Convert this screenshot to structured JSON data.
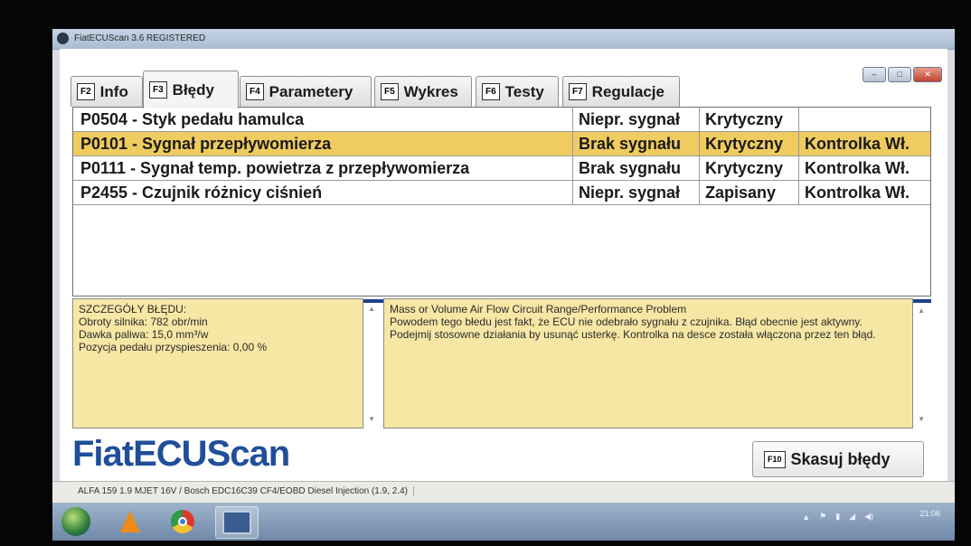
{
  "window": {
    "title": "FiatECUScan 3.6 REGISTERED",
    "controls": {
      "minimize": "–",
      "maximize": "□",
      "close": "✕"
    }
  },
  "tabs": [
    {
      "key": "F2",
      "label": "Info"
    },
    {
      "key": "F3",
      "label": "Błędy",
      "active": true
    },
    {
      "key": "F4",
      "label": "Parametery"
    },
    {
      "key": "F5",
      "label": "Wykres"
    },
    {
      "key": "F6",
      "label": "Testy"
    },
    {
      "key": "F7",
      "label": "Regulacje"
    }
  ],
  "fault_codes": [
    {
      "code": "P0504 - Styk pedału hamulca",
      "signal": "Niepr. sygnał",
      "severity": "Krytyczny",
      "lamp": ""
    },
    {
      "code": "P0101 - Sygnał przepływomierza",
      "signal": "Brak sygnału",
      "severity": "Krytyczny",
      "lamp": "Kontrolka Wł.",
      "selected": true
    },
    {
      "code": "P0111 - Sygnał temp. powietrza z przepływomierza",
      "signal": "Brak sygnału",
      "severity": "Krytyczny",
      "lamp": "Kontrolka Wł."
    },
    {
      "code": "P2455 - Czujnik różnicy ciśnień",
      "signal": "Niepr. sygnał",
      "severity": "Zapisany",
      "lamp": "Kontrolka Wł."
    }
  ],
  "details": {
    "heading": "SZCZEGÓŁY BŁĘDU:",
    "lines": [
      "Obroty silnika: 782 obr/min",
      "Dawka paliwa: 15,0 mm³/w",
      "Pozycja pedału przyspieszenia: 0,00 %"
    ]
  },
  "description": {
    "title": "Mass or Volume Air Flow Circuit Range/Performance Problem",
    "text": "Powodem tego błedu jest fakt, że ECU nie odebrało sygnału z czujnika. Błąd obecnie jest aktywny. Podejmij stosowne działania by usunąć usterkę. Kontrolka na desce została włączona przez ten błąd."
  },
  "logo": "FiatECUScan",
  "clear_button": {
    "key": "F10",
    "label": "Skasuj błędy"
  },
  "status": "ALFA 159 1.9 MJET 16V / Bosch EDC16C39 CF4/EOBD Diesel Injection (1.9, 2.4)",
  "colors": {
    "accent": "#1f4f9a",
    "selected_row": "#efcb60",
    "detail_bg": "#f7e7a5",
    "divider": "#1e3f8c"
  },
  "taskbar": {
    "icons": [
      "windows-start-icon",
      "vlc-icon",
      "chrome-icon",
      "fiatecuscan-icon"
    ],
    "tray_icons": [
      "show-hidden-icon",
      "flag-icon",
      "battery-icon",
      "network-icon",
      "volume-icon"
    ],
    "clock_time": "21:06"
  }
}
